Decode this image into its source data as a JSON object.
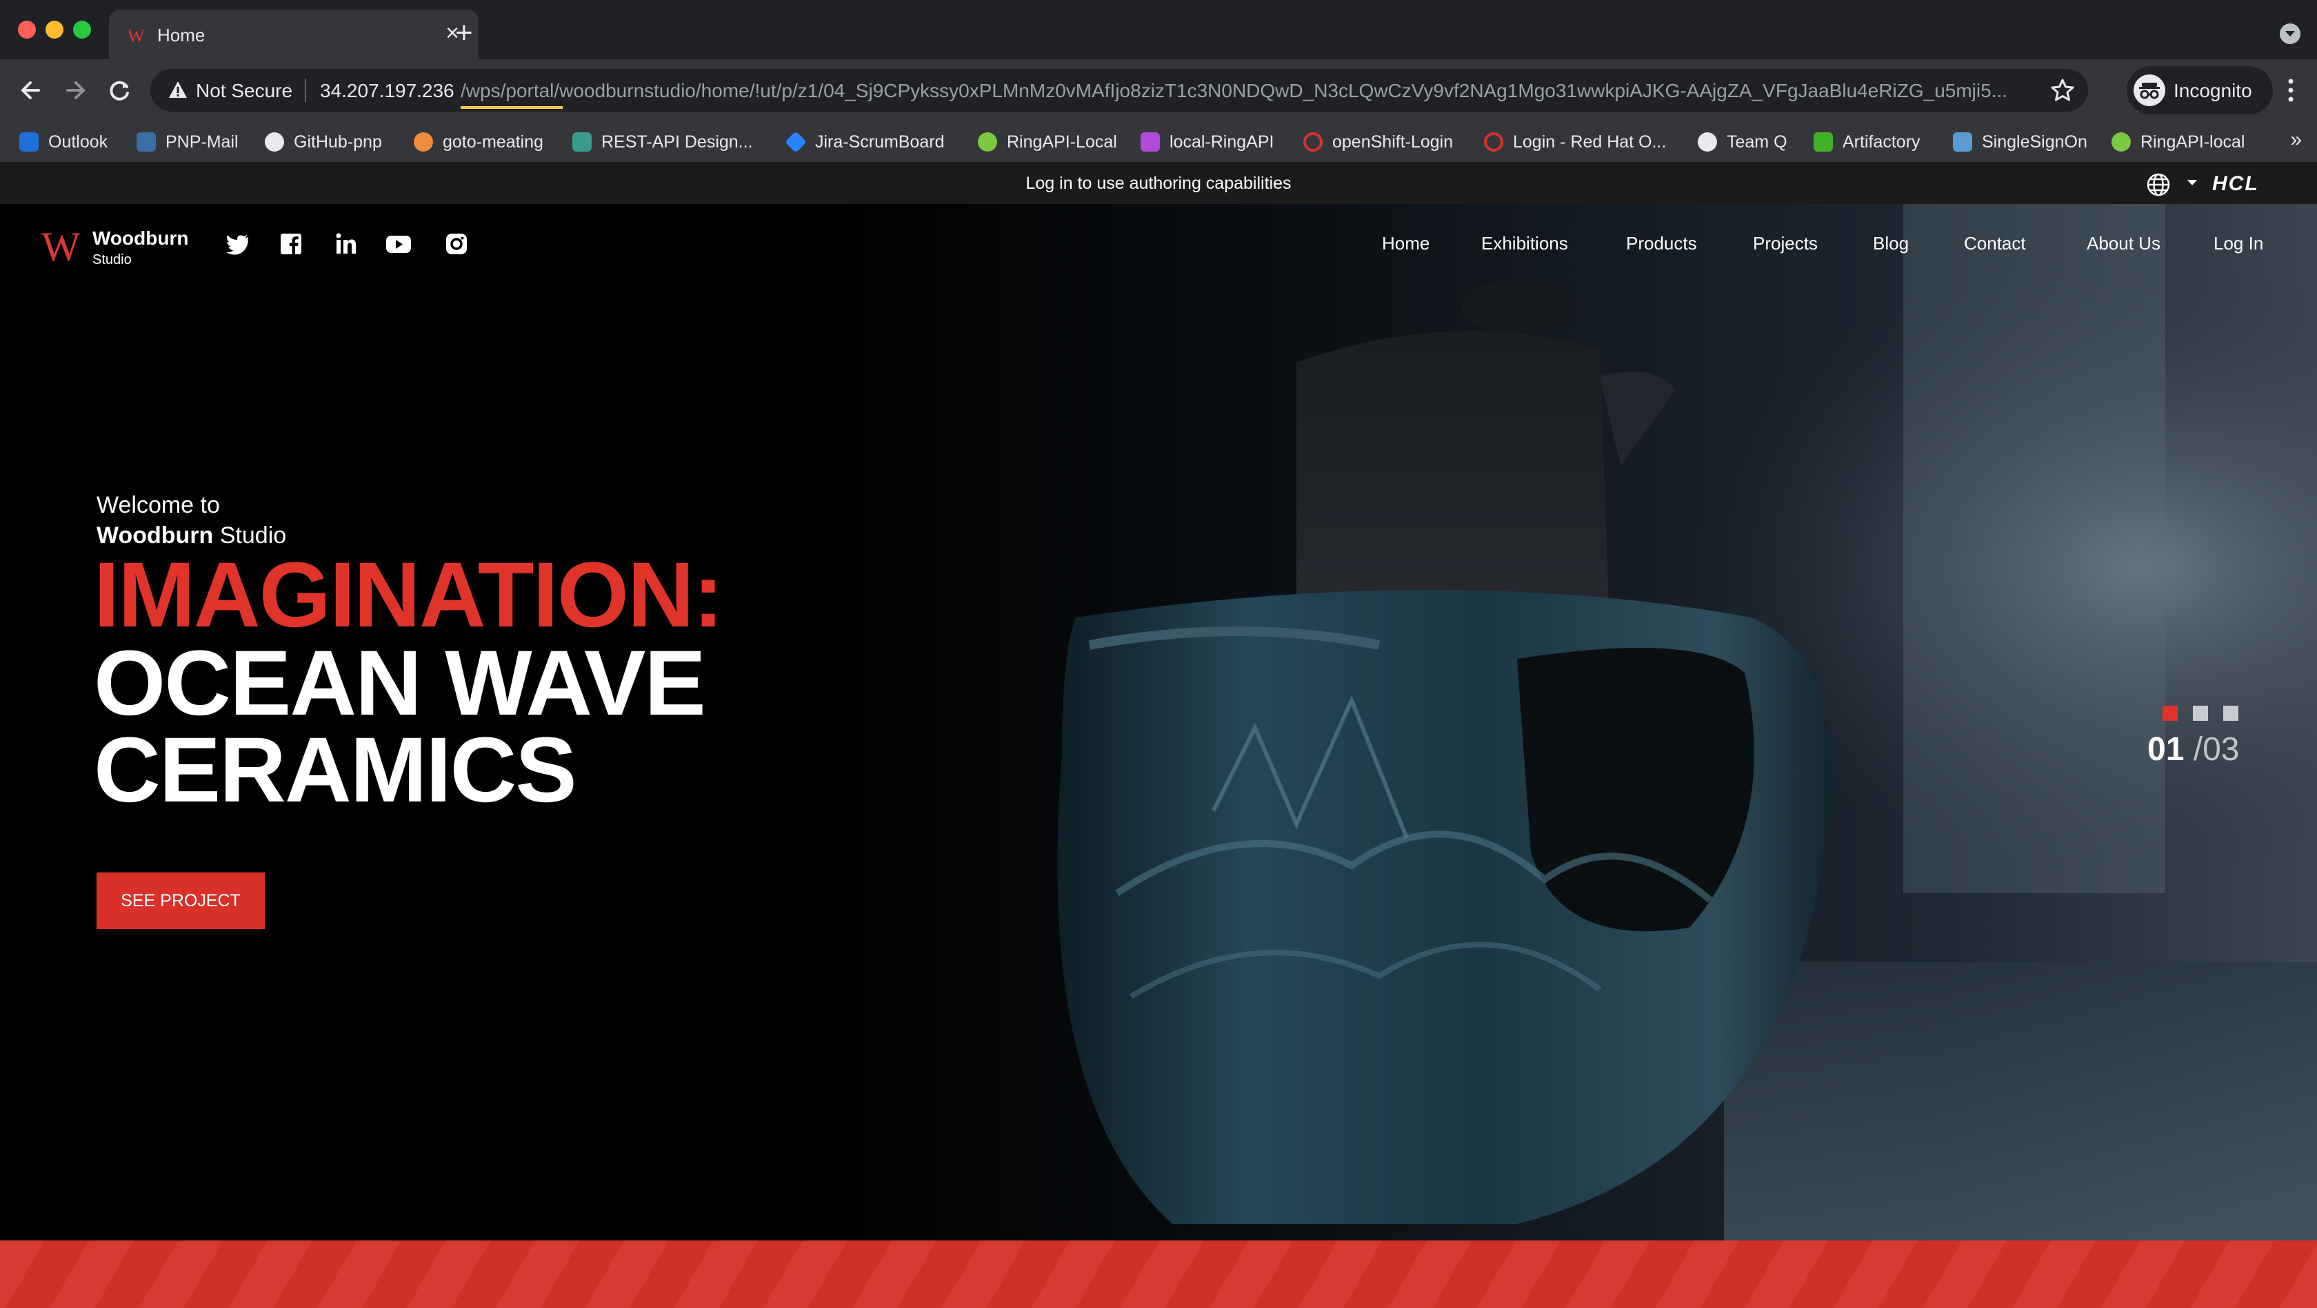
{
  "browser": {
    "tab_title": "Home",
    "new_tab_symbol": "+",
    "close_symbol": "×",
    "security_label": "Not Secure",
    "url_host": "34.207.197.236",
    "url_path": "/wps/portal/woodburnstudio/home/!ut/p/z1/04_Sj9CPykssy0xPLMnMz0vMAfIjo8zizT1c3N0NDQwD_N3cLQwCzVy9vf2NAg1Mgo31wwkpiAJKG-AAjgZA_VFgJaaBlu4eRiZG_u5mji5...",
    "profile_label": "Incognito",
    "bookmarks": [
      {
        "label": "Outlook",
        "color": "#1e6fd9"
      },
      {
        "label": "PNP-Mail",
        "color": "#3c6ea6"
      },
      {
        "label": "GitHub-pnp",
        "color": "#e8eaed"
      },
      {
        "label": "goto-meating",
        "color": "#f08c3c"
      },
      {
        "label": "REST-API Design...",
        "color": "#3a9b8c"
      },
      {
        "label": "Jira-ScrumBoard",
        "color": "#2684ff"
      },
      {
        "label": "RingAPI-Local",
        "color": "#7ac943"
      },
      {
        "label": "local-RingAPI",
        "color": "#b04ad9"
      },
      {
        "label": "openShift-Login",
        "color": "#d9302a"
      },
      {
        "label": "Login - Red Hat O...",
        "color": "#d9302a"
      },
      {
        "label": "Team Q",
        "color": "#e8eaed"
      },
      {
        "label": "Artifactory",
        "color": "#43b02a"
      },
      {
        "label": "SingleSignOn",
        "color": "#5b9bd5"
      },
      {
        "label": "RingAPI-local",
        "color": "#7ac943"
      }
    ],
    "bookmarks_more": "»"
  },
  "authoring": {
    "message": "Log in to use authoring capabilities",
    "brand": "HCL"
  },
  "site": {
    "logo_letter": "W",
    "logo_name": "Woodburn",
    "logo_sub": "Studio",
    "nav": [
      "Home",
      "Exhibitions",
      "Products",
      "Projects",
      "Blog",
      "Contact",
      "About Us",
      "Log In"
    ]
  },
  "hero": {
    "welcome": "Welcome to",
    "studio_bold": "Woodburn",
    "studio_rest": " Studio",
    "headline_red": "IMAGINATION:",
    "headline_line2": "OCEAN WAVE",
    "headline_line3": "CERAMICS",
    "cta_label": "SEE PROJECT",
    "slide_current": "01",
    "slide_total": "/03",
    "accent_color": "#e0342b"
  }
}
